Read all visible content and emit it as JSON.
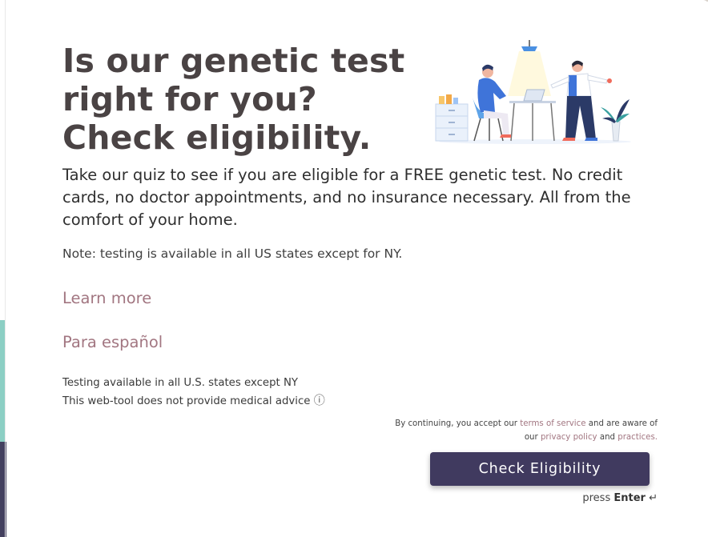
{
  "hero": {
    "title": "Is our genetic test right for you? Check eligibility.",
    "intro": "Take our quiz to see if you are eligible for a FREE genetic test. No credit cards, no doctor appointments, and no insurance necessary. All from the comfort of your home.",
    "note": "Note: testing is available in all US states except for NY."
  },
  "links": {
    "learn_more": "Learn more",
    "spanish": "Para español"
  },
  "footnote": {
    "line1": "Testing available in all U.S. states except NY",
    "line2": "This web-tool does not provide medical advice",
    "info_icon": "ⓘ"
  },
  "consent": {
    "prefix": "By continuing, you accept our",
    "terms_link": "terms of service",
    "middle": "and are aware of our",
    "privacy_link": "privacy policy",
    "and": "and",
    "practices_link": "practices."
  },
  "cta": {
    "label": "Check Eligibility",
    "press": "press",
    "key": "Enter",
    "key_icon": "↵"
  },
  "colors": {
    "title": "#4a4344",
    "link": "#a27681",
    "button_bg": "#403a5f",
    "accent_teal": "#8ccfc4",
    "accent_navy": "#43405f"
  },
  "icons": {
    "illustration": "office-consultation-illustration",
    "info": "info-circle-icon",
    "enter": "enter-return-icon"
  }
}
